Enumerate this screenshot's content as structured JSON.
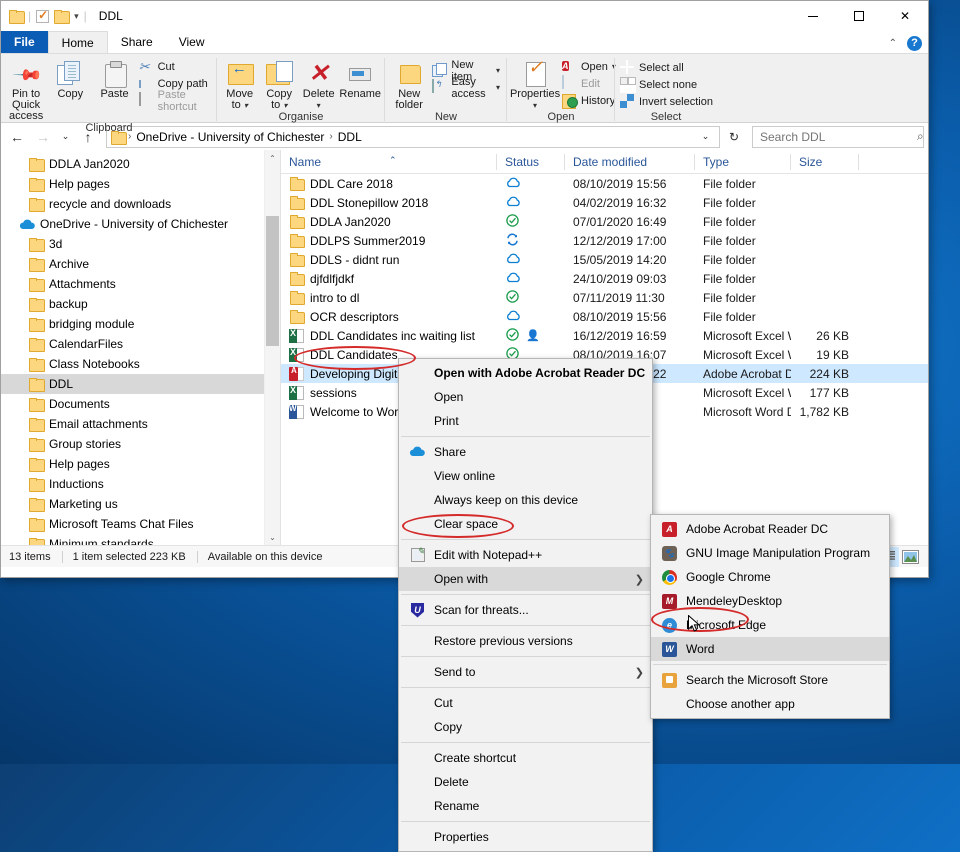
{
  "window": {
    "title": "DDL",
    "quick_access": [
      "folder-icon",
      "properties-check-icon",
      "new-folder-icon",
      "customize-caret"
    ],
    "controls": {
      "minimize": "minimize",
      "maximize": "maximize",
      "close": "close"
    }
  },
  "ribbon": {
    "tabs": [
      {
        "label": "File",
        "active": false,
        "kind": "file"
      },
      {
        "label": "Home",
        "active": true,
        "kind": "normal"
      },
      {
        "label": "Share",
        "active": false,
        "kind": "normal"
      },
      {
        "label": "View",
        "active": false,
        "kind": "normal"
      }
    ],
    "help_label": "?",
    "groups": [
      {
        "name": "Clipboard",
        "big": [
          {
            "label": "Pin to Quick\naccess",
            "icon": "pin-icon"
          },
          {
            "label": "Copy",
            "icon": "copy-icon"
          },
          {
            "label": "Paste",
            "icon": "paste-icon"
          }
        ],
        "small": [
          {
            "label": "Cut",
            "icon": "scissors-icon",
            "disabled": false
          },
          {
            "label": "Copy path",
            "icon": "copy-path-icon",
            "disabled": false
          },
          {
            "label": "Paste shortcut",
            "icon": "paste-shortcut-icon",
            "disabled": true
          }
        ]
      },
      {
        "name": "Organise",
        "big": [
          {
            "label": "Move\nto",
            "icon": "move-to-icon",
            "dropdown": true
          },
          {
            "label": "Copy\nto",
            "icon": "copy-to-icon",
            "dropdown": true
          },
          {
            "label": "Delete",
            "icon": "delete-icon",
            "dropdown": true
          },
          {
            "label": "Rename",
            "icon": "rename-icon"
          }
        ],
        "small": []
      },
      {
        "name": "New",
        "big": [
          {
            "label": "New\nfolder",
            "icon": "new-folder-icon"
          }
        ],
        "small": [
          {
            "label": "New item",
            "icon": "new-item-icon",
            "dropdown": true
          },
          {
            "label": "Easy access",
            "icon": "easy-access-icon",
            "dropdown": true
          }
        ]
      },
      {
        "name": "Open",
        "big": [
          {
            "label": "Properties",
            "icon": "properties-icon",
            "dropdown": true
          }
        ],
        "small": [
          {
            "label": "Open",
            "icon": "open-pdf-icon",
            "dropdown": true
          },
          {
            "label": "Edit",
            "icon": "edit-icon",
            "disabled": true
          },
          {
            "label": "History",
            "icon": "history-icon"
          }
        ]
      },
      {
        "name": "Select",
        "big": [],
        "small": [
          {
            "label": "Select all",
            "icon": "select-all-icon"
          },
          {
            "label": "Select none",
            "icon": "select-none-icon"
          },
          {
            "label": "Invert selection",
            "icon": "invert-selection-icon"
          }
        ]
      }
    ]
  },
  "addressbar": {
    "back": "back-arrow",
    "forward": "forward-arrow",
    "recent": "recent-caret",
    "up": "up-arrow",
    "breadcrumbs": [
      "OneDrive - University of Chichester",
      "DDL"
    ],
    "dropdown_caret": "address-dropdown",
    "refresh": "refresh-icon",
    "search_placeholder": "Search DDL",
    "search_value": ""
  },
  "navpane": {
    "items": [
      {
        "label": "DDLA Jan2020",
        "icon": "folder-icon",
        "indent": true,
        "selected": false
      },
      {
        "label": "Help pages",
        "icon": "folder-icon",
        "indent": true,
        "selected": false
      },
      {
        "label": "recycle and downloads",
        "icon": "folder-icon",
        "indent": true,
        "selected": false
      },
      {
        "label": "OneDrive - University of Chichester",
        "icon": "cloud-icon",
        "indent": false,
        "selected": false
      },
      {
        "label": "3d",
        "icon": "folder-icon",
        "indent": true,
        "selected": false
      },
      {
        "label": "Archive",
        "icon": "folder-icon",
        "indent": true,
        "selected": false
      },
      {
        "label": "Attachments",
        "icon": "folder-icon",
        "indent": true,
        "selected": false
      },
      {
        "label": "backup",
        "icon": "folder-icon",
        "indent": true,
        "selected": false
      },
      {
        "label": "bridging module",
        "icon": "folder-icon",
        "indent": true,
        "selected": false
      },
      {
        "label": "CalendarFiles",
        "icon": "folder-icon",
        "indent": true,
        "selected": false
      },
      {
        "label": "Class Notebooks",
        "icon": "folder-icon",
        "indent": true,
        "selected": false
      },
      {
        "label": "DDL",
        "icon": "folder-icon",
        "indent": true,
        "selected": true
      },
      {
        "label": "Documents",
        "icon": "folder-icon",
        "indent": true,
        "selected": false
      },
      {
        "label": "Email attachments",
        "icon": "folder-icon",
        "indent": true,
        "selected": false
      },
      {
        "label": "Group stories",
        "icon": "folder-icon",
        "indent": true,
        "selected": false
      },
      {
        "label": "Help pages",
        "icon": "folder-icon",
        "indent": true,
        "selected": false
      },
      {
        "label": "Inductions",
        "icon": "folder-icon",
        "indent": true,
        "selected": false
      },
      {
        "label": "Marketing us",
        "icon": "folder-icon",
        "indent": true,
        "selected": false
      },
      {
        "label": "Microsoft Teams Chat Files",
        "icon": "folder-icon",
        "indent": true,
        "selected": false
      },
      {
        "label": "Minimum standards",
        "icon": "folder-icon",
        "indent": true,
        "selected": false
      }
    ]
  },
  "filelist": {
    "columns": [
      "Name",
      "Status",
      "Date modified",
      "Type",
      "Size"
    ],
    "sorted_by": "Name",
    "sort_direction": "ascending",
    "rows": [
      {
        "name": "DDL Care 2018",
        "icon": "folder-icon",
        "status": "cloud-only",
        "shared": false,
        "date": "08/10/2019 15:56",
        "type": "File folder",
        "size": "",
        "selected": false
      },
      {
        "name": "DDL Stonepillow 2018",
        "icon": "folder-icon",
        "status": "cloud-only",
        "shared": false,
        "date": "04/02/2019 16:32",
        "type": "File folder",
        "size": "",
        "selected": false
      },
      {
        "name": "DDLA Jan2020",
        "icon": "folder-icon",
        "status": "available",
        "shared": false,
        "date": "07/01/2020 16:49",
        "type": "File folder",
        "size": "",
        "selected": false
      },
      {
        "name": "DDLPS Summer2019",
        "icon": "folder-icon",
        "status": "syncing",
        "shared": false,
        "date": "12/12/2019 17:00",
        "type": "File folder",
        "size": "",
        "selected": false
      },
      {
        "name": "DDLS - didnt run",
        "icon": "folder-icon",
        "status": "cloud-only",
        "shared": false,
        "date": "15/05/2019 14:20",
        "type": "File folder",
        "size": "",
        "selected": false
      },
      {
        "name": "djfdlfjdkf",
        "icon": "folder-icon",
        "status": "cloud-only",
        "shared": false,
        "date": "24/10/2019 09:03",
        "type": "File folder",
        "size": "",
        "selected": false
      },
      {
        "name": "intro to dl",
        "icon": "folder-icon",
        "status": "available",
        "shared": false,
        "date": "07/11/2019 11:30",
        "type": "File folder",
        "size": "",
        "selected": false
      },
      {
        "name": "OCR descriptors",
        "icon": "folder-icon",
        "status": "cloud-only",
        "shared": false,
        "date": "08/10/2019 15:56",
        "type": "File folder",
        "size": "",
        "selected": false
      },
      {
        "name": "DDL Candidates inc waiting list",
        "icon": "excel-icon",
        "status": "available",
        "shared": true,
        "date": "16/12/2019 16:59",
        "type": "Microsoft Excel W...",
        "size": "26 KB",
        "selected": false
      },
      {
        "name": "DDL Candidates",
        "icon": "excel-icon",
        "status": "available",
        "shared": false,
        "date": "08/10/2019 16:07",
        "type": "Microsoft Excel W...",
        "size": "19 KB",
        "selected": false
      },
      {
        "name": "Developing Digital Capability Plan - technical",
        "icon": "pdf-icon",
        "status": "cloud-only",
        "shared": false,
        "date": "10/12/2019 12:22",
        "type": "Adobe Acrobat D...",
        "size": "224 KB",
        "selected": true
      },
      {
        "name": "sessions",
        "icon": "excel-icon",
        "status": "",
        "shared": false,
        "date": "",
        "type": "Microsoft Excel W...",
        "size": "177 KB",
        "selected": false
      },
      {
        "name": "Welcome to Word",
        "icon": "word-icon",
        "status": "",
        "shared": false,
        "date": "",
        "type": "Microsoft Word D...",
        "size": "1,782 KB",
        "selected": false
      }
    ]
  },
  "statusbar": {
    "item_count": "13 items",
    "selection": "1 item selected  223 KB",
    "availability": "Available on this device",
    "views": [
      {
        "name": "details-view",
        "active": true
      },
      {
        "name": "large-icons-view",
        "active": false
      }
    ]
  },
  "contextmenu": {
    "items": [
      {
        "label": "Open with Adobe Acrobat Reader DC",
        "bold": true,
        "icon": "",
        "submenu": false
      },
      {
        "label": "Open",
        "bold": false,
        "icon": "",
        "submenu": false
      },
      {
        "label": "Print",
        "bold": false,
        "icon": "",
        "submenu": false
      },
      {
        "separator": true
      },
      {
        "label": "Share",
        "bold": false,
        "icon": "onedrive-cloud-icon",
        "submenu": false
      },
      {
        "label": "View online",
        "bold": false,
        "icon": "",
        "submenu": false
      },
      {
        "label": "Always keep on this device",
        "bold": false,
        "icon": "",
        "submenu": false
      },
      {
        "label": "Clear space",
        "bold": false,
        "icon": "",
        "submenu": false
      },
      {
        "separator": true
      },
      {
        "label": "Edit with Notepad++",
        "bold": false,
        "icon": "notepadpp-icon",
        "submenu": false
      },
      {
        "label": "Open with",
        "bold": false,
        "icon": "",
        "submenu": true,
        "highlighted": true
      },
      {
        "separator": true
      },
      {
        "label": "Scan for threats...",
        "bold": false,
        "icon": "shield-icon",
        "submenu": false
      },
      {
        "separator": true
      },
      {
        "label": "Restore previous versions",
        "bold": false,
        "icon": "",
        "submenu": false
      },
      {
        "separator": true
      },
      {
        "label": "Send to",
        "bold": false,
        "icon": "",
        "submenu": true
      },
      {
        "separator": true
      },
      {
        "label": "Cut",
        "bold": false,
        "icon": "",
        "submenu": false
      },
      {
        "label": "Copy",
        "bold": false,
        "icon": "",
        "submenu": false
      },
      {
        "separator": true
      },
      {
        "label": "Create shortcut",
        "bold": false,
        "icon": "",
        "submenu": false
      },
      {
        "label": "Delete",
        "bold": false,
        "icon": "",
        "submenu": false
      },
      {
        "label": "Rename",
        "bold": false,
        "icon": "",
        "submenu": false
      },
      {
        "separator": true
      },
      {
        "label": "Properties",
        "bold": false,
        "icon": "",
        "submenu": false
      }
    ]
  },
  "openwith_submenu": {
    "items": [
      {
        "label": "Adobe Acrobat Reader DC",
        "icon": "adobe-acrobat-icon",
        "highlighted": false
      },
      {
        "label": "GNU Image Manipulation Program",
        "icon": "gimp-icon",
        "highlighted": false
      },
      {
        "label": "Google Chrome",
        "icon": "chrome-icon",
        "highlighted": false
      },
      {
        "label": "MendeleyDesktop",
        "icon": "mendeley-icon",
        "highlighted": false
      },
      {
        "label": "Microsoft Edge",
        "icon": "edge-icon",
        "highlighted": false
      },
      {
        "label": "Word",
        "icon": "word-icon",
        "highlighted": true
      },
      {
        "separator": true
      },
      {
        "label": "Search the Microsoft Store",
        "icon": "microsoft-store-icon",
        "highlighted": false
      },
      {
        "label": "Choose another app",
        "icon": "",
        "highlighted": false
      }
    ]
  },
  "annotations": {
    "color": "#d42a2a",
    "ellipses": [
      {
        "target": "selected-pdf-file"
      },
      {
        "target": "open-with-menu-item"
      },
      {
        "target": "word-submenu-item"
      }
    ]
  }
}
